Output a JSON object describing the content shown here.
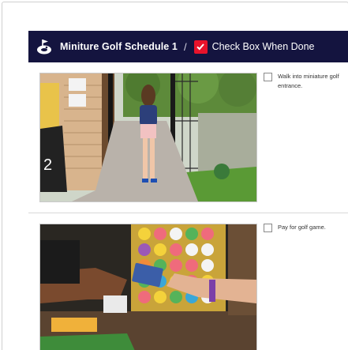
{
  "header": {
    "title": "Miniture Golf Schedule 1",
    "separator": "/",
    "label": "Check Box When Done"
  },
  "tasks": [
    {
      "text": "Walk into miniature golf entrance.",
      "checked": false
    },
    {
      "text": "Pay for golf game.",
      "checked": false
    }
  ],
  "photo_scene_1": {
    "sign_number": "2"
  },
  "colors": {
    "header_bg": "#14143f",
    "check_red": "#e8132b"
  }
}
